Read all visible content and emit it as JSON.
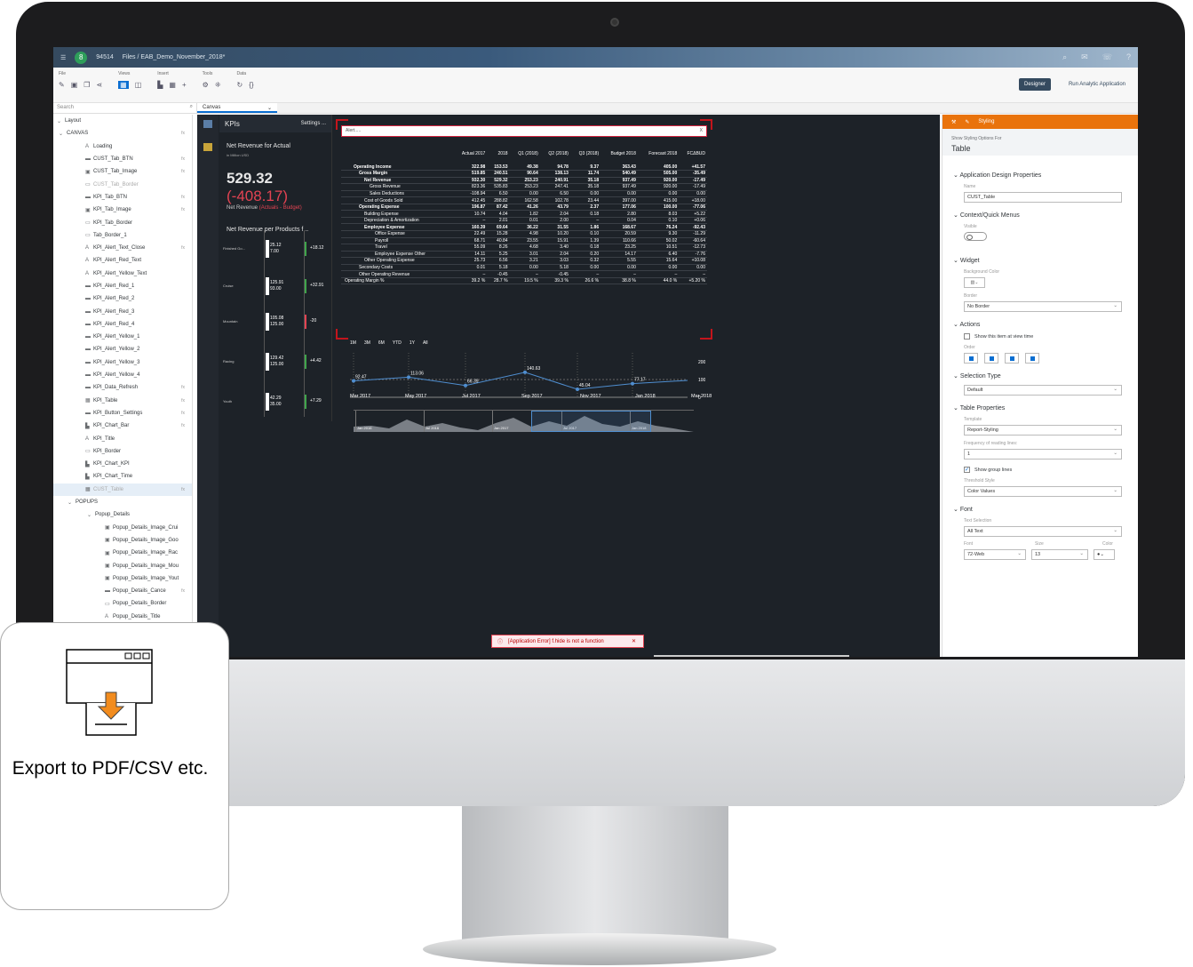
{
  "shell": {
    "id": "94514",
    "breadcrumb": "Files / EAB_Demo_November_2018*"
  },
  "toolbar": {
    "groups": [
      {
        "label": "File"
      },
      {
        "label": "Views"
      },
      {
        "label": "Insert"
      },
      {
        "label": "Tools"
      },
      {
        "label": "Data"
      }
    ],
    "designer": "Designer",
    "run": "Run Analytic Application"
  },
  "search_placeholder": "Search",
  "canvas_tab": "Canvas",
  "outline": {
    "layout": "Layout",
    "canvas": "CANVAS",
    "items": [
      "Loading",
      "CUST_Tab_BTN",
      "CUST_Tab_Image",
      "CUST_Tab_Border",
      "KPI_Tab_BTN",
      "KPI_Tab_Image",
      "KPI_Tab_Border",
      "Tab_Border_1",
      "KPI_Alert_Text_Close",
      "KPI_Alert_Red_Text",
      "KPI_Alert_Yellow_Text",
      "KPI_Alert_Red_1",
      "KPI_Alert_Red_2",
      "KPI_Alert_Red_3",
      "KPI_Alert_Red_4",
      "KPI_Alert_Yellow_1",
      "KPI_Alert_Yellow_2",
      "KPI_Alert_Yellow_3",
      "KPI_Alert_Yellow_4",
      "KPI_Data_Refresh",
      "KPI_Table",
      "KPI_Button_Settings",
      "KPI_Chart_Bar",
      "KPI_Title",
      "KPI_Border",
      "KPI_Chart_KPI",
      "KPI_Chart_Time",
      "CUST_Table"
    ],
    "popups": "POPUPS",
    "popup_details": "Popup_Details",
    "popup_items": [
      "Popup_Details_Image_Crui",
      "Popup_Details_Image_Goo",
      "Popup_Details_Image_Rac",
      "Popup_Details_Image_Mou",
      "Popup_Details_Image_Yout",
      "Popup_Details_Cance",
      "Popup_Details_Border",
      "Popup_Details_Title"
    ]
  },
  "kpi": {
    "title": "KPIs",
    "settings": "Settings ...",
    "net_rev_title": "Net Revenue for Actual",
    "unit": "in Million USD",
    "value": "529.32",
    "diff": "(-408.17)",
    "label": "Net Revenue",
    "label_sub": "(Actuals - Budget)",
    "products_title": "Net Revenue per Products f...",
    "bars": [
      {
        "cat": "Finished Go...",
        "v1": "25.12",
        "v2": "7.00",
        "diff": "+18.12"
      },
      {
        "cat": "Cruise",
        "v1": "125.91",
        "v2": "93.00",
        "diff": "+32.91"
      },
      {
        "cat": "Mountain",
        "v1": "105.08",
        "v2": "125.00",
        "diff": "-20"
      },
      {
        "cat": "Racing",
        "v1": "129.42",
        "v2": "125.00",
        "diff": "+4.42"
      },
      {
        "cat": "Youth",
        "v1": "42.29",
        "v2": "35.00",
        "diff": "+7.29"
      }
    ]
  },
  "alert": {
    "placeholder": "Alert.....",
    "close": "X"
  },
  "table": {
    "headers": [
      "",
      "Actual 2017",
      "2018",
      "Q1 (2018)",
      "Q2 (2018)",
      "Q3 (2018)",
      "Budget 2018",
      "Forecast 2018",
      "FCΔBUD"
    ],
    "rows": [
      [
        "Operating Income",
        "322.98",
        "153.53",
        "49.38",
        "94.78",
        "9.37",
        "363.43",
        "405.00",
        "+41.57"
      ],
      [
        "Gross Margin",
        "519.85",
        "240.51",
        "90.64",
        "138.13",
        "11.74",
        "540.49",
        "505.00",
        "-35.49"
      ],
      [
        "Net Revenue",
        "932.30",
        "529.32",
        "253.23",
        "240.91",
        "35.18",
        "937.49",
        "920.00",
        "-17.49"
      ],
      [
        "Gross Revenue",
        "823.36",
        "535.83",
        "253.23",
        "247.41",
        "35.18",
        "937.49",
        "920.00",
        "-17.49"
      ],
      [
        "Sales Deductions",
        "-108.94",
        "6.50",
        "0.00",
        "6.50",
        "0.00",
        "0.00",
        "0.00",
        "0.00"
      ],
      [
        "Cost of Goods Sold",
        "412.45",
        "288.82",
        "162.58",
        "102.78",
        "23.44",
        "397.00",
        "415.00",
        "+18.00"
      ],
      [
        "Operating Expense",
        "196.87",
        "87.42",
        "41.26",
        "43.79",
        "2.37",
        "177.06",
        "100.00",
        "-77.06"
      ],
      [
        "Building Expense",
        "10.74",
        "4.04",
        "1.82",
        "2.04",
        "0.18",
        "2.80",
        "8.03",
        "+5.22"
      ],
      [
        "Depreciation & Amortization",
        "–",
        "2.01",
        "0.01",
        "2.00",
        "–",
        "0.04",
        "0.10",
        "+0.06"
      ],
      [
        "Employee Expense",
        "160.39",
        "69.64",
        "36.22",
        "31.55",
        "1.86",
        "168.67",
        "76.24",
        "-92.43"
      ],
      [
        "Office Expense",
        "22.49",
        "15.28",
        "4.98",
        "10.20",
        "0.10",
        "20.59",
        "9.30",
        "-11.29"
      ],
      [
        "Payroll",
        "68.71",
        "40.84",
        "23.55",
        "15.91",
        "1.39",
        "110.66",
        "50.02",
        "-60.64"
      ],
      [
        "Travel",
        "55.09",
        "8.26",
        "4.68",
        "3.40",
        "0.18",
        "23.25",
        "10.51",
        "-12.73"
      ],
      [
        "Employee Expense Other",
        "14.11",
        "5.25",
        "3.01",
        "2.04",
        "0.20",
        "14.17",
        "6.40",
        "-7.76"
      ],
      [
        "Other Operating Expense",
        "25.73",
        "6.56",
        "3.21",
        "3.03",
        "0.32",
        "5.55",
        "15.64",
        "+10.08"
      ],
      [
        "Secondary Costs",
        "0.01",
        "5.18",
        "0.00",
        "5.18",
        "0.00",
        "0.00",
        "0.00",
        "0.00"
      ],
      [
        "Other Operating Revenue",
        "–",
        "-0.45",
        "–",
        "-0.45",
        "–",
        "–",
        "–",
        "–"
      ],
      [
        "Operating Margin %",
        "39.2 %",
        "28.7 %",
        "19.5 %",
        "39.3 %",
        "26.6 %",
        "38.8 %",
        "44.0 %",
        "+5.20 %"
      ]
    ]
  },
  "timechart": {
    "periods": [
      "1M",
      "3M",
      "6M",
      "YTD",
      "1Y",
      "All"
    ],
    "points": [
      92.47,
      113.06,
      66.39,
      140.63,
      45.04,
      77.17
    ],
    "labels": [
      "92.47",
      "113.06",
      "66.39",
      "140.63",
      "45.04",
      "77.17"
    ],
    "yticks": [
      "200",
      "100",
      "0"
    ],
    "xlabels": [
      "Mar 2017",
      "May 2017",
      "Jul 2017",
      "Sep 2017",
      "Nov 2017",
      "Jan 2018",
      "Mar 2018"
    ],
    "nav": [
      "Jan 2016",
      "Jul 2016",
      "Jan 2017",
      "Jul 2017",
      "Jan 2018"
    ]
  },
  "error": "[Application Error] f.hide is not a function",
  "styling": {
    "tab": "Styling",
    "show_for": "Show Styling Options For",
    "target": "Table",
    "app_props": "Application Design Properties",
    "name_label": "Name",
    "name_value": "CUST_Table",
    "context": "Context/Quick Menus",
    "visible": "Visible",
    "widget": "Widget",
    "bg": "Background Color",
    "border": "Border",
    "border_value": "No Border",
    "actions": "Actions",
    "show_view": "Show this item at view time",
    "order": "Order",
    "sel_type": "Selection Type",
    "sel_value": "Default",
    "table_props": "Table Properties",
    "template": "Template",
    "template_value": "Report-Styling",
    "freq": "Frequency of reading lines:",
    "freq_value": "1",
    "group_lines": "Show group lines",
    "threshold": "Threshold Style",
    "threshold_value": "Color Values",
    "font": "Font",
    "text_sel": "Text Selection",
    "text_sel_value": "All Text",
    "font_label": "Font",
    "size_label": "Size",
    "color_label": "Color",
    "font_value": "72-Web",
    "size_value": "13"
  },
  "export": {
    "label": "Export to PDF/CSV etc."
  }
}
